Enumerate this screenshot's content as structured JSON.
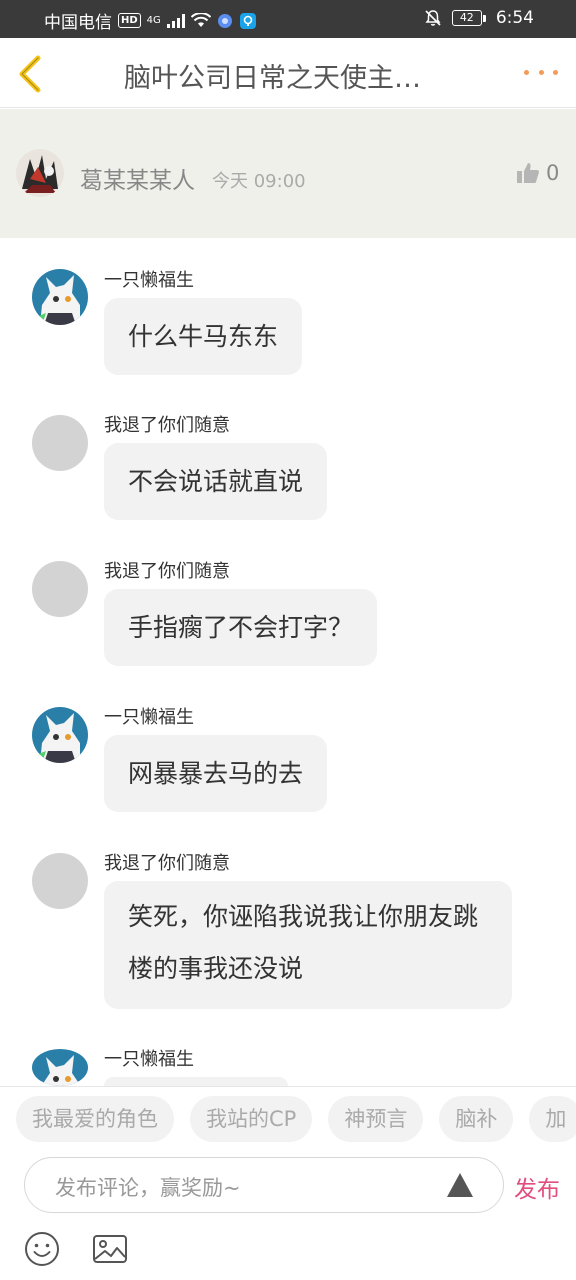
{
  "status_bar": {
    "carrier": "中国电信",
    "hd": "HD",
    "network": "4G",
    "battery": "42",
    "time": "6:54"
  },
  "header": {
    "title": "脑叶公司日常之天使主…"
  },
  "author": {
    "name": "葛某某某人",
    "time": "今天 09:00",
    "likes": "0"
  },
  "messages": [
    {
      "sender": "一只懒福生",
      "text": "什么牛马东东",
      "avatar": "character"
    },
    {
      "sender": "我退了你们随意",
      "text": "不会说话就直说",
      "avatar": "gray"
    },
    {
      "sender": "我退了你们随意",
      "text": "手指瘸了不会打字？",
      "avatar": "gray"
    },
    {
      "sender": "一只懒福生",
      "text": "网暴暴去马的去",
      "avatar": "character"
    },
    {
      "sender": "我退了你们随意",
      "text": "笑死，你诬陷我说我让你朋友跳楼的事我还没说",
      "avatar": "gray"
    },
    {
      "sender": "一只懒福生",
      "text": "",
      "avatar": "character"
    }
  ],
  "tags": [
    "我最爱的角色",
    "我站的CP",
    "神预言",
    "脑补",
    "加"
  ],
  "input": {
    "placeholder": "发布评论，赢奖励~",
    "publish_label": "发布"
  },
  "colors": {
    "accent_orange": "#f39c5a",
    "publish_pink": "#e0507e",
    "back_arrow": "#f5c518"
  }
}
